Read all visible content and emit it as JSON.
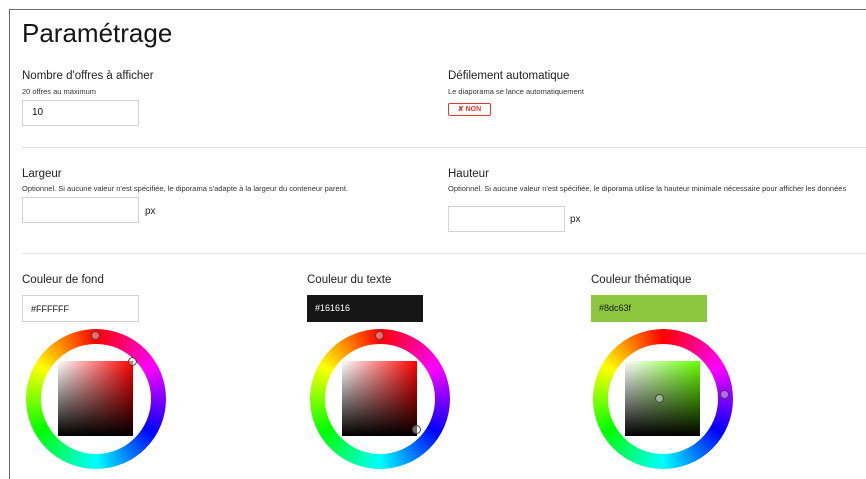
{
  "page": {
    "title": "Paramétrage"
  },
  "offers": {
    "label": "Nombre d'offres à afficher",
    "help": "20 offres au maximum",
    "value": "10"
  },
  "autoscroll": {
    "label": "Défilement automatique",
    "help": "Le diaporama se lance automatiquement",
    "toggle_label": "✘ NON",
    "toggle_color": "#e0392b"
  },
  "width": {
    "label": "Largeur",
    "help": "Optionnel. Si aucune valeur n'est spécifiée, le diporama s'adapte à la largeur du conteneur parent.",
    "value": "",
    "unit": "px"
  },
  "height": {
    "label": "Hauteur",
    "help": "Optionnel. Si aucune valeur n'est spécifiée, le diporama utilise la hauteur minimale nécessaire pour afficher les données",
    "value": "",
    "unit": "px"
  },
  "colors": {
    "background": {
      "label": "Couleur de fond",
      "value": "#FFFFFF",
      "hex": "#ffffff"
    },
    "text": {
      "label": "Couleur du texte",
      "value": "#161616",
      "hex": "#161616"
    },
    "theme": {
      "label": "Couleur thématique",
      "value": "#8dc63f",
      "hex": "#8dc63f"
    }
  }
}
